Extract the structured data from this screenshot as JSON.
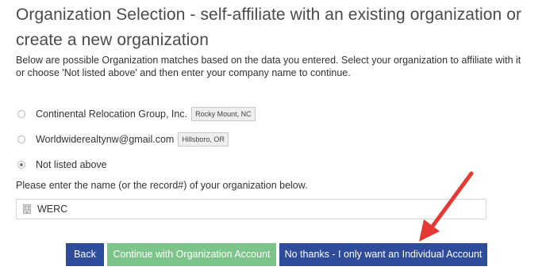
{
  "title": "Organization Selection - self-affiliate with an existing organization or create a new organization",
  "description": "Below are possible Organization matches based on the data you entered. Select your organization to affiliate with it or choose 'Not listed above' and then enter your company name to continue.",
  "options": [
    {
      "label": "Continental Relocation Group, Inc.",
      "location": "Rocky Mount, NC",
      "selected": false
    },
    {
      "label": "Worldwiderealtynw@gmail.com",
      "location": "Hillsboro, OR",
      "selected": false
    },
    {
      "label": "Not listed above",
      "selected": true
    }
  ],
  "prompt": "Please enter the name (or the record#) of your organization below.",
  "org_input": {
    "value": "WERC",
    "icon": "building-icon"
  },
  "buttons": {
    "back": "Back",
    "continue": "Continue with Organization Account",
    "individual": "No thanks - I only want an Individual Account"
  },
  "annotation": {
    "type": "arrow",
    "color": "#e53935",
    "points_to": "individual-account-button"
  },
  "colors": {
    "primary": "#2e4c9a",
    "success": "#7cc48a",
    "arrow": "#e53935"
  }
}
